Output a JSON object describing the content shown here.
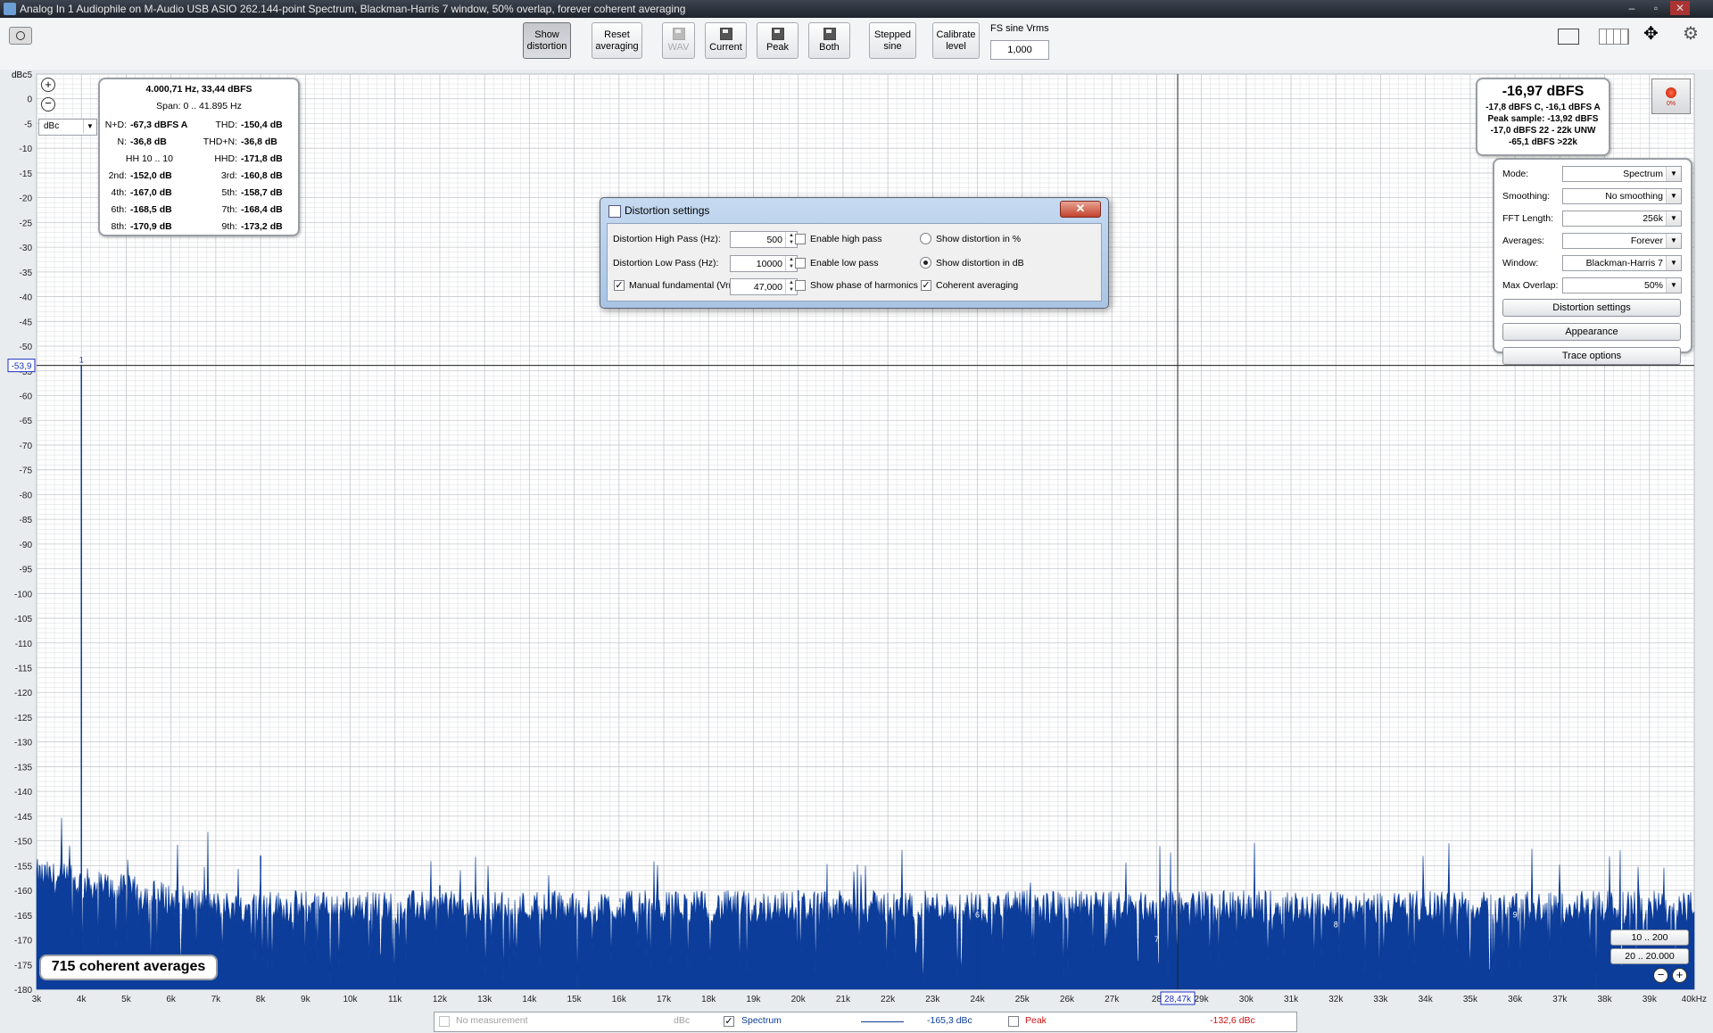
{
  "window": {
    "title": "Analog In 1 Audiophile on M-Audio USB ASIO 262.144-point Spectrum, Blackman-Harris 7 window, 50% overlap, forever coherent averaging",
    "minimize": "–",
    "maximize": "▫",
    "close": "✕"
  },
  "toolbar": {
    "show_distortion": [
      "Show",
      "distortion"
    ],
    "reset_averaging": [
      "Reset",
      "averaging"
    ],
    "wav": "WAV",
    "current": "Current",
    "peak": "Peak",
    "both": "Both",
    "stepped_sine": [
      "Stepped",
      "sine"
    ],
    "calibrate_level": [
      "Calibrate",
      "level"
    ],
    "fs_sine_label": "FS sine Vrms",
    "fs_sine_value": "1,000"
  },
  "plot": {
    "y_unit": "dBc",
    "y_unit_select": "dBc",
    "x_unit": "kHz",
    "cursor_y_label": "-53,9",
    "cursor_x_label": "28,47k",
    "averages_badge": "715 coherent averages",
    "y_ticks": [
      "5",
      "0",
      "-5",
      "-10",
      "-15",
      "-20",
      "-25",
      "-30",
      "-35",
      "-40",
      "-45",
      "-50",
      "-55",
      "-60",
      "-65",
      "-70",
      "-75",
      "-80",
      "-85",
      "-90",
      "-95",
      "-100",
      "-105",
      "-110",
      "-115",
      "-120",
      "-125",
      "-130",
      "-135",
      "-140",
      "-145",
      "-150",
      "-155",
      "-160",
      "-165",
      "-170",
      "-175",
      "-180"
    ],
    "x_ticks": [
      "3k",
      "4k",
      "5k",
      "6k",
      "7k",
      "8k",
      "9k",
      "10k",
      "11k",
      "12k",
      "13k",
      "14k",
      "15k",
      "16k",
      "17k",
      "18k",
      "19k",
      "20k",
      "21k",
      "22k",
      "23k",
      "24k",
      "25k",
      "26k",
      "27k",
      "28",
      "29k",
      "30k",
      "31k",
      "32k",
      "33k",
      "34k",
      "35k",
      "36k",
      "37k",
      "38k",
      "39k",
      "40kHz"
    ],
    "harmonic_markers": [
      {
        "label": "1",
        "freq_khz": 4.0,
        "level_dbc": -53.9
      },
      {
        "label": "2",
        "freq_khz": 8.0,
        "level_dbc": -153
      },
      {
        "label": "3",
        "freq_khz": 12.0,
        "level_dbc": -159
      },
      {
        "label": "4",
        "freq_khz": 16.0,
        "level_dbc": -164
      },
      {
        "label": "5",
        "freq_khz": 20.0,
        "level_dbc": -160
      },
      {
        "label": "6",
        "freq_khz": 24.0,
        "level_dbc": -166
      },
      {
        "label": "7",
        "freq_khz": 28.0,
        "level_dbc": -171
      },
      {
        "label": "8",
        "freq_khz": 32.0,
        "level_dbc": -168
      },
      {
        "label": "9",
        "freq_khz": 36.0,
        "level_dbc": -166
      }
    ],
    "zoom_200": "10 .. 200",
    "zoom_20000": "20 .. 20.000",
    "colors": {
      "trace": "#0c3d9a",
      "grid_major": "#c4c8cd",
      "grid_minor": "#d9dcdf",
      "cursor": "#222222"
    }
  },
  "distortion_panel": {
    "frequency_line": "4.000,71 Hz, 33,44 dBFS",
    "span_line": "Span: 0 .. 41.895 Hz",
    "rows": [
      {
        "l1": "N+D:",
        "v1": "-67,3 dBFS A",
        "l2": "THD:",
        "v2": "-150,4 dB"
      },
      {
        "l1": "N:",
        "v1": "-36,8 dB",
        "l2": "THD+N:",
        "v2": "-36,8 dB"
      },
      {
        "l1": "HH 10 .. 10",
        "v1": "",
        "l2": "HHD:",
        "v2": "-171,8 dB"
      },
      {
        "l1": "2nd:",
        "v1": "-152,0 dB",
        "l2": "3rd:",
        "v2": "-160,8 dB"
      },
      {
        "l1": "4th:",
        "v1": "-167,0 dB",
        "l2": "5th:",
        "v2": "-158,7 dB"
      },
      {
        "l1": "6th:",
        "v1": "-168,5 dB",
        "l2": "7th:",
        "v2": "-168,4 dB"
      },
      {
        "l1": "8th:",
        "v1": "-170,9 dB",
        "l2": "9th:",
        "v2": "-173,2 dB"
      }
    ]
  },
  "level_panel": {
    "main": "-16,97 dBFS",
    "line1": "-17,8 dBFS C, -16,1 dBFS A",
    "line2": "Peak sample: -13,92 dBFS",
    "line3": "-17,0 dBFS 22 - 22k UNW",
    "line4": "-65,1 dBFS >22k",
    "record_pct": "0%"
  },
  "settings_panel": {
    "mode_label": "Mode:",
    "mode_value": "Spectrum",
    "smoothing_label": "Smoothing:",
    "smoothing_value": "No  smoothing",
    "fft_label": "FFT Length:",
    "fft_value": "256k",
    "averages_label": "Averages:",
    "averages_value": "Forever",
    "window_label": "Window:",
    "window_value": "Blackman-Harris 7",
    "overlap_label": "Max Overlap:",
    "overlap_value": "50%",
    "distortion_settings_button": "Distortion settings",
    "appearance_button": "Appearance",
    "trace_options_button": "Trace options"
  },
  "dialog": {
    "title": "Distortion settings",
    "close": "✕",
    "high_pass_label": "Distortion High Pass (Hz):",
    "high_pass_value": "500",
    "low_pass_label": "Distortion Low Pass (Hz):",
    "low_pass_value": "10000",
    "manual_fundamental_label": "Manual fundamental (Vrms)",
    "manual_fundamental_value": "47,000",
    "enable_high_pass": "Enable high pass",
    "enable_low_pass": "Enable low pass",
    "show_phase": "Show phase of harmonics",
    "show_percent": "Show distortion in %",
    "show_db": "Show distortion in dB",
    "coherent_averaging": "Coherent averaging"
  },
  "legend": {
    "no_measurement": "No measurement",
    "no_measurement_unit": "dBc",
    "spectrum": "Spectrum",
    "spectrum_value": "-165,3 dBc",
    "peak": "Peak",
    "peak_value": "-132,6 dBc",
    "spectrum_color": "#0c3d9a",
    "peak_color": "#cc1111"
  }
}
